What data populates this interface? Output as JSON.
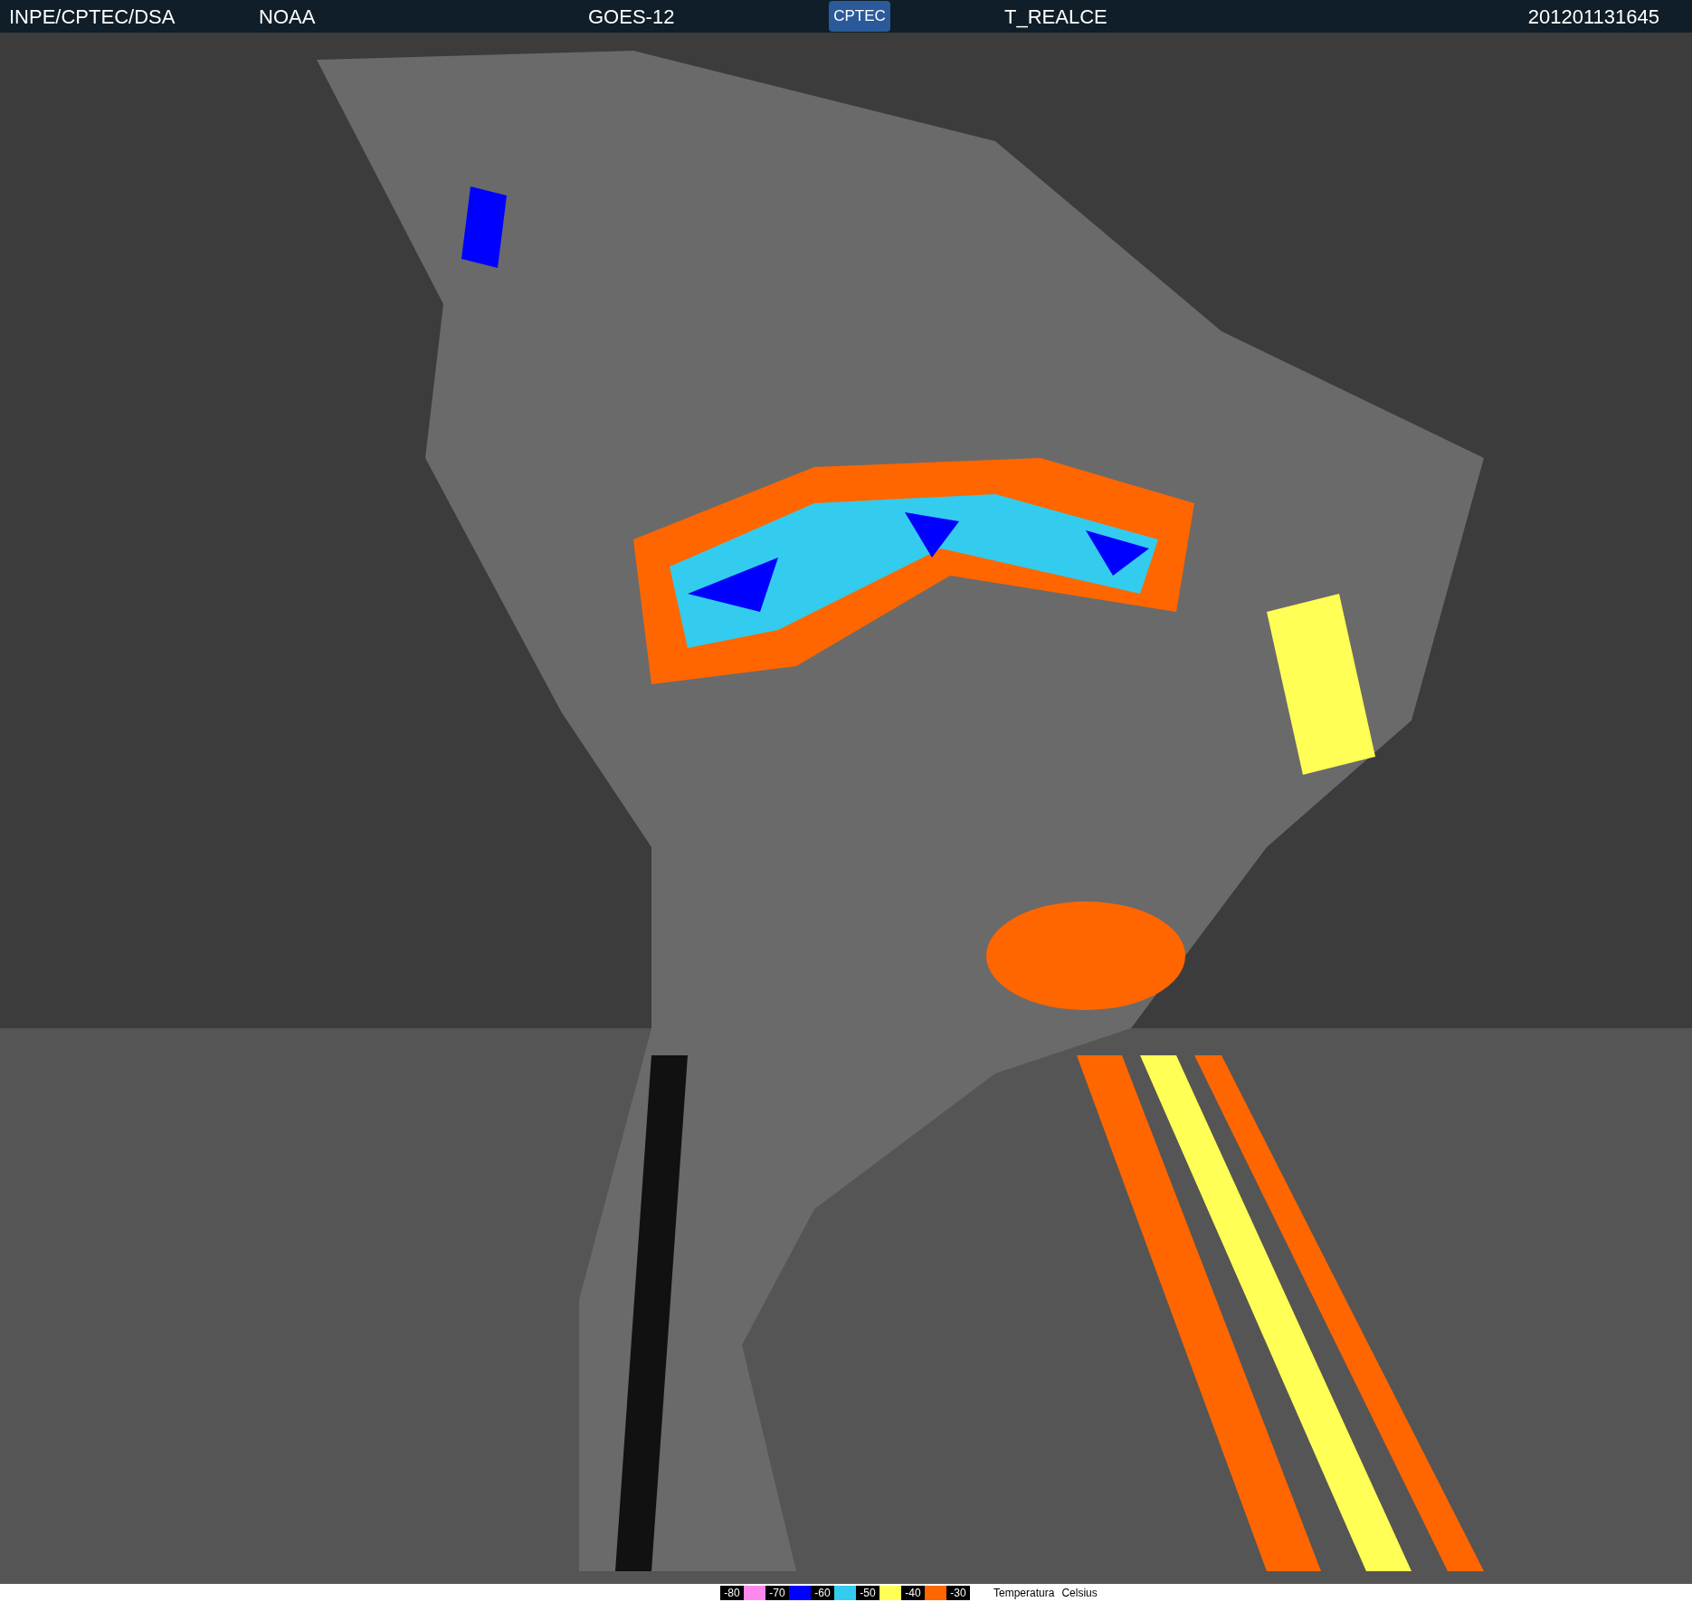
{
  "header": {
    "source": "INPE/CPTEC/DSA",
    "agency": "NOAA",
    "satellite": "GOES-12",
    "logo": "CPTEC",
    "product": "T_REALCE",
    "timestamp": "201201131645"
  },
  "legend": {
    "items": [
      {
        "label": "-80",
        "color": "#ff88ee"
      },
      {
        "label": "-70",
        "color": "#0000ff"
      },
      {
        "label": "-60",
        "color": "#33ccee"
      },
      {
        "label": "-50",
        "color": "#ffff55"
      },
      {
        "label": "-40",
        "color": "#ff6600"
      },
      {
        "label": "-30"
      }
    ],
    "title": "Temperatura",
    "unit": "Celsius"
  }
}
